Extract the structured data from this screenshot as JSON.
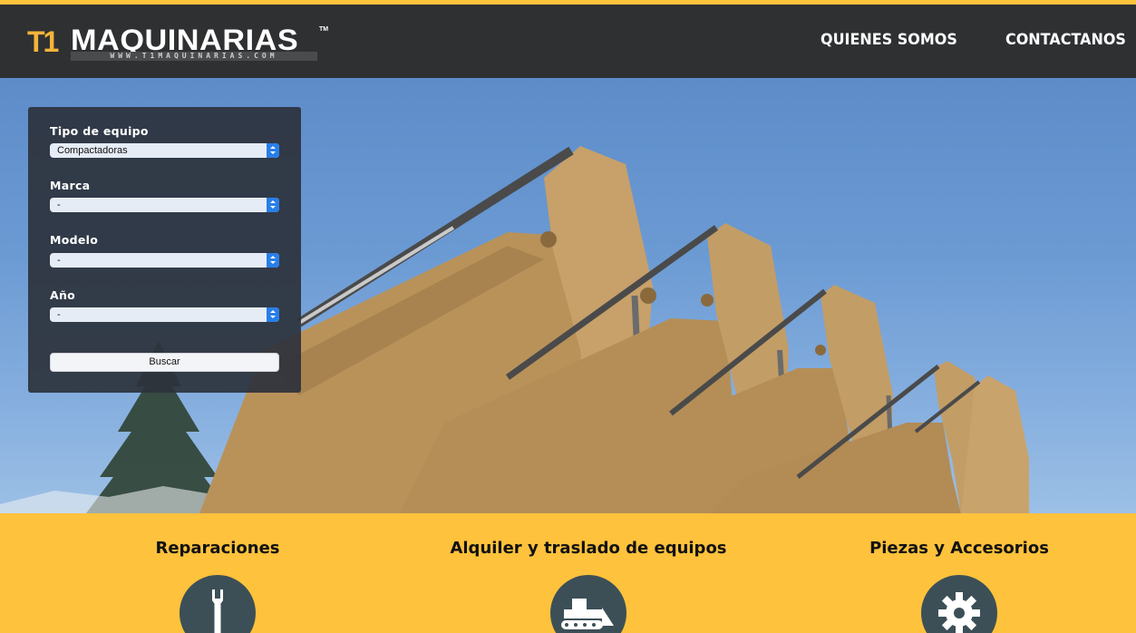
{
  "brand": {
    "mark": "T1",
    "name": "MAQUINARIAS",
    "tm": "TM",
    "url": "WWW.T1MAQUINARIAS.COM"
  },
  "nav": {
    "items": [
      {
        "label": "QUIENES SOMOS"
      },
      {
        "label": "CONTACTANOS"
      }
    ]
  },
  "search": {
    "fields": [
      {
        "label": "Tipo de equipo",
        "value": "Compactadoras"
      },
      {
        "label": "Marca",
        "value": "-"
      },
      {
        "label": "Modelo",
        "value": "-"
      },
      {
        "label": "Año",
        "value": "-"
      }
    ],
    "button_label": "Buscar"
  },
  "services": [
    {
      "title": "Reparaciones",
      "icon": "wrench-icon"
    },
    {
      "title": "Alquiler y traslado de equipos",
      "icon": "bulldozer-icon"
    },
    {
      "title": "Piezas y Accesorios",
      "icon": "gear-icon"
    }
  ],
  "colors": {
    "accent": "#ffc23c",
    "header": "#2f3032",
    "panel": "#2c323c",
    "icon_circle": "#3c4f57",
    "select_button": "#2a7ee8"
  }
}
